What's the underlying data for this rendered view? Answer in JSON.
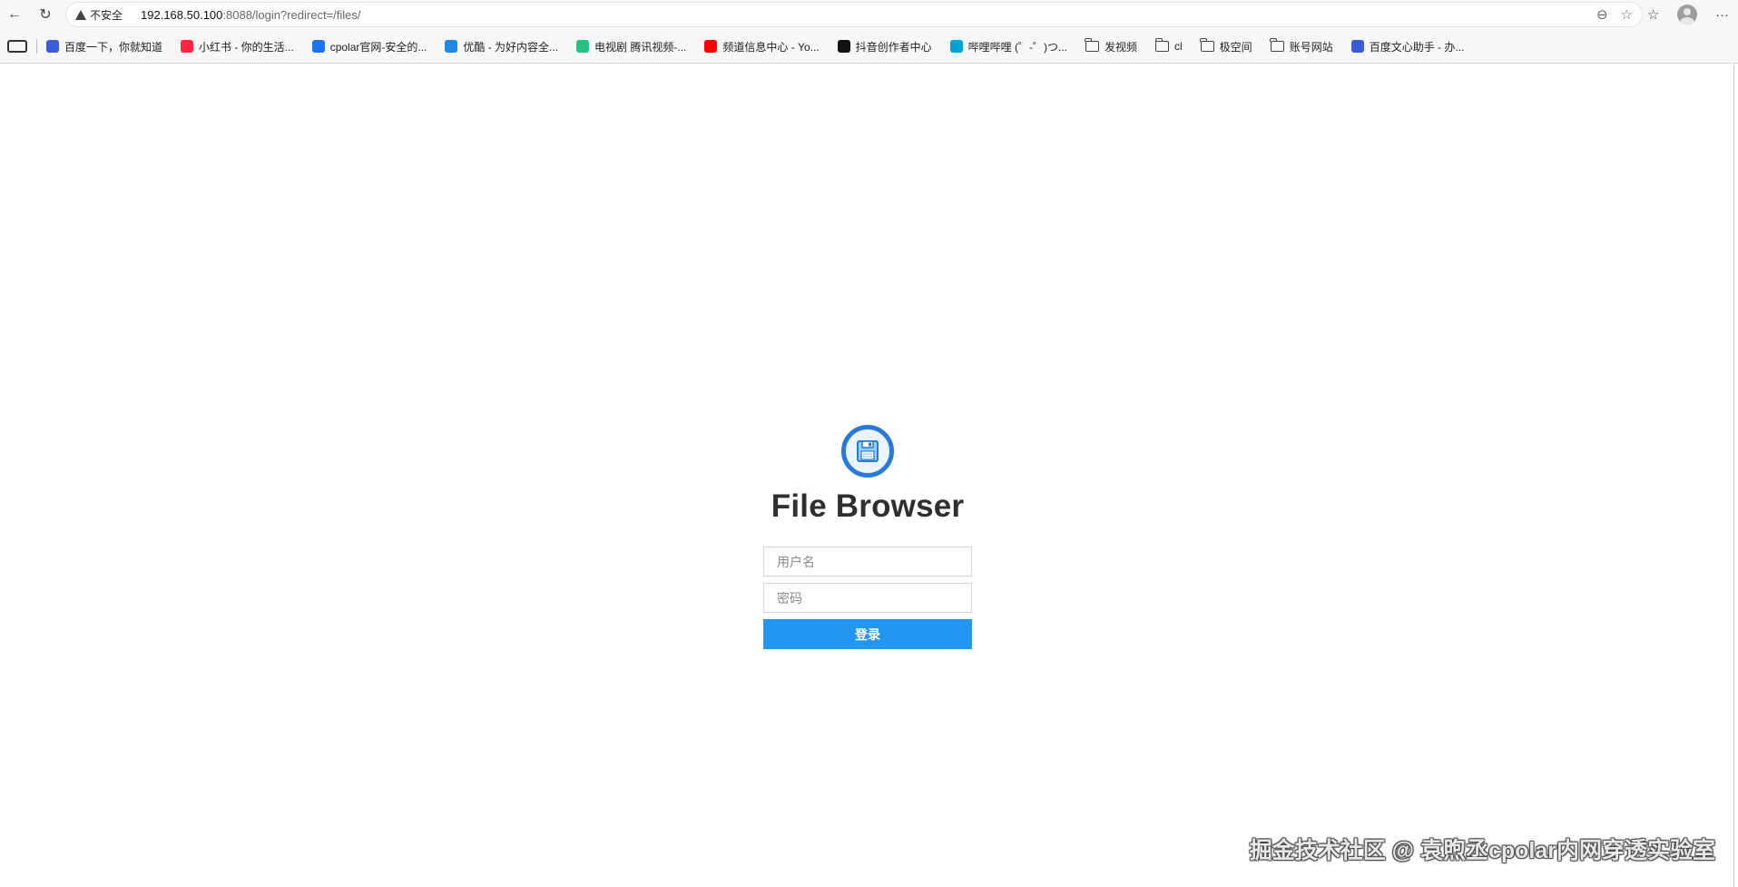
{
  "browser": {
    "insecure_label": "不安全",
    "url_host": "192.168.50.100",
    "url_rest": ":8088/login?redirect=/files/"
  },
  "bookmarks": [
    {
      "label": "百度一下，你就知道",
      "color": "#3b5bdb"
    },
    {
      "label": "小红书 - 你的生活...",
      "color": "#ff2442"
    },
    {
      "label": "cpolar官网-安全的...",
      "color": "#1a73e8"
    },
    {
      "label": "优酷 - 为好内容全...",
      "color": "#1e88e5"
    },
    {
      "label": "电视剧 腾讯视频-...",
      "color": "#26c281"
    },
    {
      "label": "频道信息中心 - Yo...",
      "color": "#ff0000"
    },
    {
      "label": "抖音创作者中心",
      "color": "#111111"
    },
    {
      "label": "哔哩哔哩 (゜-゜)つ...",
      "color": "#00a1d6"
    },
    {
      "label": "发视频",
      "folder": true
    },
    {
      "label": "cl",
      "folder": true
    },
    {
      "label": "极空间",
      "folder": true
    },
    {
      "label": "账号网站",
      "folder": true
    },
    {
      "label": "百度文心助手 - 办...",
      "color": "#3b5bdb"
    }
  ],
  "login": {
    "title": "File Browser",
    "username_placeholder": "用户名",
    "password_placeholder": "密码",
    "submit_label": "登录"
  },
  "watermark": "掘金技术社区 @ 袁煦丞cpolar内网穿透实验室",
  "colors": {
    "primary": "#2196f3",
    "logo_ring": "#2979d8"
  }
}
